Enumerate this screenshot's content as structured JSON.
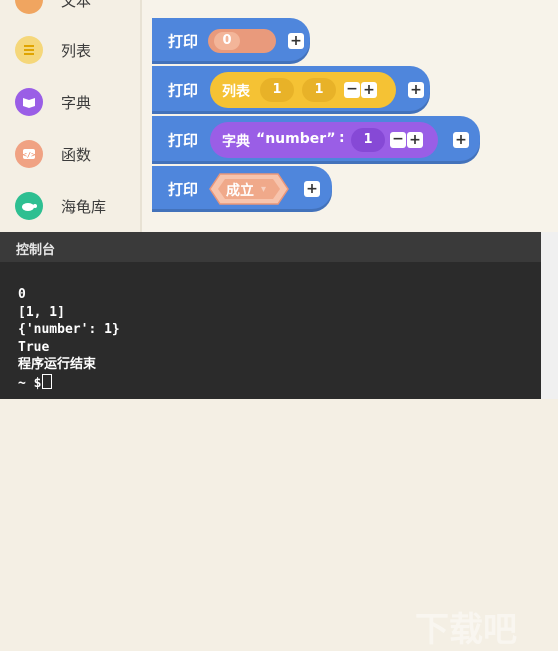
{
  "sidebar": {
    "items": [
      {
        "label": "文本",
        "icon": "text-icon",
        "color": "#f0a560"
      },
      {
        "label": "列表",
        "icon": "list-icon",
        "color": "#f5c234"
      },
      {
        "label": "字典",
        "icon": "dictionary-icon",
        "color": "#9a5ee6"
      },
      {
        "label": "函数",
        "icon": "function-icon",
        "color": "#e97c51"
      },
      {
        "label": "海龟库",
        "icon": "turtle-icon",
        "color": "#2ebf91"
      }
    ]
  },
  "blocks": {
    "print_keyword": "打印",
    "b1": {
      "value": "0"
    },
    "b2": {
      "label": "列表",
      "v1": "1",
      "v2": "1"
    },
    "b3": {
      "label": "字典",
      "key": "“number”",
      "sep": ":",
      "value": "1"
    },
    "b4": {
      "value": "成立"
    }
  },
  "console": {
    "title": "控制台",
    "lines": [
      "0",
      "[1, 1]",
      "{'number': 1}",
      "True",
      "程序运行结束"
    ],
    "prompt": "~ $"
  },
  "watermark": "下载吧"
}
